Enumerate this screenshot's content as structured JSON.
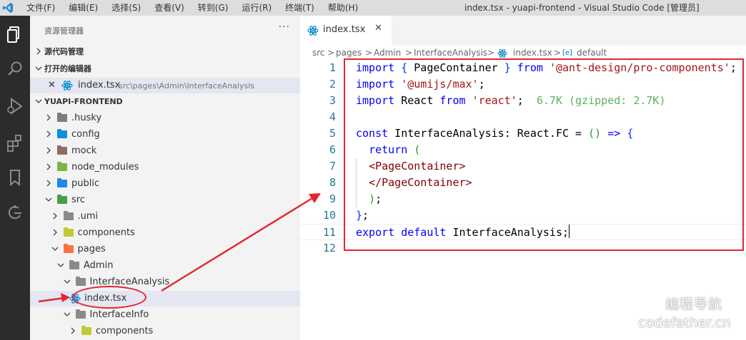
{
  "menu": [
    "文件(F)",
    "编辑(E)",
    "选择(S)",
    "查看(V)",
    "转到(G)",
    "运行(R)",
    "终端(T)",
    "帮助(H)"
  ],
  "window_title": "index.tsx - yuapi-frontend - Visual Studio Code [管理员]",
  "sidebar": {
    "title": "资源管理器",
    "more": "···",
    "source_control": "源代码管理",
    "open_editors": "打开的编辑器",
    "open_file": {
      "name": "index.tsx",
      "path": "src\\pages\\Admin\\InterfaceAnalysis"
    },
    "project": "YUAPI-FRONTEND",
    "tree": [
      {
        "name": ".husky",
        "level": 0,
        "open": false,
        "color": "#7d7d7d"
      },
      {
        "name": "config",
        "level": 0,
        "open": false,
        "color": "#0d8fdb"
      },
      {
        "name": "mock",
        "level": 0,
        "open": false,
        "color": "#8d6e63"
      },
      {
        "name": "node_modules",
        "level": 0,
        "open": false,
        "color": "#7cb342"
      },
      {
        "name": "public",
        "level": 0,
        "open": false,
        "color": "#1e88e5"
      },
      {
        "name": "src",
        "level": 0,
        "open": true,
        "color": "#43a047"
      },
      {
        "name": ".umi",
        "level": 1,
        "open": false,
        "color": "#8a8a8a"
      },
      {
        "name": "components",
        "level": 1,
        "open": false,
        "color": "#c0ca33"
      },
      {
        "name": "pages",
        "level": 1,
        "open": true,
        "color": "#ff7043"
      },
      {
        "name": "Admin",
        "level": 2,
        "open": true,
        "color": "#8a8a8a"
      },
      {
        "name": "InterfaceAnalysis",
        "level": 3,
        "open": true,
        "color": "#8a8a8a"
      },
      {
        "name": "index.tsx",
        "level": 4,
        "file": true,
        "selected": true
      },
      {
        "name": "InterfaceInfo",
        "level": 3,
        "open": true,
        "color": "#8a8a8a"
      },
      {
        "name": "components",
        "level": 4,
        "open": false,
        "color": "#c0ca33"
      }
    ]
  },
  "editor": {
    "tab": {
      "label": "index.tsx",
      "close": "✕"
    },
    "breadcrumb": [
      "src",
      ">",
      "pages",
      ">",
      "Admin",
      ">",
      "InterfaceAnalysis",
      ">",
      "index.tsx",
      ">",
      "default"
    ],
    "line_numbers": [
      "1",
      "2",
      "3",
      "4",
      "5",
      "6",
      "7",
      "8",
      "9",
      "10",
      "11",
      "12"
    ],
    "lines": [
      "import { PageContainer } from '@ant-design/pro-components';",
      "import '@umijs/max';",
      "import React from 'react';  6.7K (gzipped: 2.7K)",
      "",
      "const InterfaceAnalysis: React.FC = () => {",
      "  return (",
      "  <PageContainer>",
      "  </PageContainer>",
      "  );",
      "};",
      "export default InterfaceAnalysis;",
      ""
    ]
  },
  "watermark": {
    "line1": "编程导航",
    "line2": "codefather.cn"
  },
  "colors": {
    "activity_bar": "#2c2c2c",
    "sidebar": "#f3f3f3",
    "annotation": "#e3252f",
    "react_icon": "#0288d1"
  }
}
